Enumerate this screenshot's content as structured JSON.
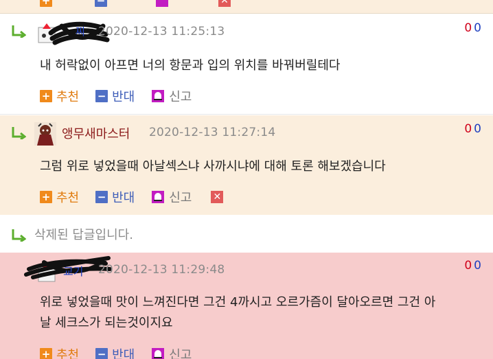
{
  "top_strip": {
    "partial_actions": [
      "추천",
      "반대",
      "신고"
    ]
  },
  "comments": [
    {
      "nickname": "",
      "nickname_partial": "찌",
      "timestamp": "2020-12-13 11:25:13",
      "votes": {
        "up": "0",
        "down": "0"
      },
      "body": "내 허락없이 아프면 너의 항문과 입의 위치를 바꿔버릴테다",
      "actions": {
        "recommend": "추천",
        "oppose": "반대",
        "report": "신고"
      }
    },
    {
      "nickname": "앵무새마스터",
      "timestamp": "2020-12-13 11:27:14",
      "votes": {
        "up": "0",
        "down": "0"
      },
      "body": "그럼 위로 넣었을때 아날섹스냐 사까시냐에 대해 토론 해보겠습니다",
      "actions": {
        "recommend": "추천",
        "oppose": "반대",
        "report": "신고"
      }
    },
    {
      "deleted_text": "삭제된 답글입니다."
    },
    {
      "nickname": "",
      "nickname_partial": "교기",
      "timestamp": "2020-12-13 11:29:48",
      "votes": {
        "up": "0",
        "down": "0"
      },
      "body_line1": "위로 넣었을때 맛이 느껴진다면 그건 4까시고 오르가즘이 달아오르면 그건 아",
      "body_line2": "날 세크스가 되는것이지요",
      "actions": {
        "recommend": "추천",
        "oppose": "반대",
        "report": "신고"
      }
    }
  ],
  "colors": {
    "cream_bg": "#fbeedd",
    "pink_bg": "#f7cccc",
    "recommend": "#e07c10",
    "oppose": "#3d5db8",
    "vote_up": "#d0021b",
    "vote_down": "#1f3fbf",
    "nickname_dark_red": "#8b1a1a"
  },
  "icons": [
    "reply-arrow-icon",
    "plus-icon",
    "minus-icon",
    "report-bell-icon",
    "close-icon"
  ]
}
